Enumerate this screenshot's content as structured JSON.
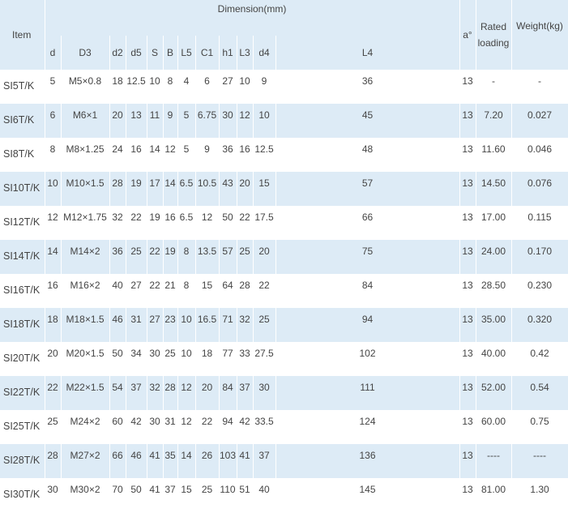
{
  "table": {
    "header": {
      "item": "Item",
      "dimension": "Dimension(mm)",
      "angle": "a°",
      "rated_loading": "Rated loading",
      "weight": "Weight(kg)",
      "columns": [
        "d",
        "D3",
        "d2",
        "d5",
        "S",
        "B",
        "L5",
        "C1",
        "h1",
        "L3",
        "d4",
        "L4"
      ]
    },
    "rows": [
      {
        "item": "SI5T/K",
        "d": "5",
        "D3": "M5×0.8",
        "d2": "18",
        "d5": "12.5",
        "S": "10",
        "B": "8",
        "L5": "4",
        "C1": "6",
        "h1": "27",
        "L3": "10",
        "d4": "9",
        "L4": "36",
        "a": "13",
        "rated": "-",
        "weight": "-"
      },
      {
        "item": "SI6T/K",
        "d": "6",
        "D3": "M6×1",
        "d2": "20",
        "d5": "13",
        "S": "11",
        "B": "9",
        "L5": "5",
        "C1": "6.75",
        "h1": "30",
        "L3": "12",
        "d4": "10",
        "L4": "45",
        "a": "13",
        "rated": "7.20",
        "weight": "0.027"
      },
      {
        "item": "SI8T/K",
        "d": "8",
        "D3": "M8×1.25",
        "d2": "24",
        "d5": "16",
        "S": "14",
        "B": "12",
        "L5": "5",
        "C1": "9",
        "h1": "36",
        "L3": "16",
        "d4": "12.5",
        "L4": "48",
        "a": "13",
        "rated": "11.60",
        "weight": "0.046"
      },
      {
        "item": "SI10T/K",
        "d": "10",
        "D3": "M10×1.5",
        "d2": "28",
        "d5": "19",
        "S": "17",
        "B": "14",
        "L5": "6.5",
        "C1": "10.5",
        "h1": "43",
        "L3": "20",
        "d4": "15",
        "L4": "57",
        "a": "13",
        "rated": "14.50",
        "weight": "0.076"
      },
      {
        "item": "SI12T/K",
        "d": "12",
        "D3": "M12×1.75",
        "d2": "32",
        "d5": "22",
        "S": "19",
        "B": "16",
        "L5": "6.5",
        "C1": "12",
        "h1": "50",
        "L3": "22",
        "d4": "17.5",
        "L4": "66",
        "a": "13",
        "rated": "17.00",
        "weight": "0.115"
      },
      {
        "item": "SI14T/K",
        "d": "14",
        "D3": "M14×2",
        "d2": "36",
        "d5": "25",
        "S": "22",
        "B": "19",
        "L5": "8",
        "C1": "13.5",
        "h1": "57",
        "L3": "25",
        "d4": "20",
        "L4": "75",
        "a": "13",
        "rated": "24.00",
        "weight": "0.170"
      },
      {
        "item": "SI16T/K",
        "d": "16",
        "D3": "M16×2",
        "d2": "40",
        "d5": "27",
        "S": "22",
        "B": "21",
        "L5": "8",
        "C1": "15",
        "h1": "64",
        "L3": "28",
        "d4": "22",
        "L4": "84",
        "a": "13",
        "rated": "28.50",
        "weight": "0.230"
      },
      {
        "item": "SI18T/K",
        "d": "18",
        "D3": "M18×1.5",
        "d2": "46",
        "d5": "31",
        "S": "27",
        "B": "23",
        "L5": "10",
        "C1": "16.5",
        "h1": "71",
        "L3": "32",
        "d4": "25",
        "L4": "94",
        "a": "13",
        "rated": "35.00",
        "weight": "0.320"
      },
      {
        "item": "SI20T/K",
        "d": "20",
        "D3": "M20×1.5",
        "d2": "50",
        "d5": "34",
        "S": "30",
        "B": "25",
        "L5": "10",
        "C1": "18",
        "h1": "77",
        "L3": "33",
        "d4": "27.5",
        "L4": "102",
        "a": "13",
        "rated": "40.00",
        "weight": "0.42"
      },
      {
        "item": "SI22T/K",
        "d": "22",
        "D3": "M22×1.5",
        "d2": "54",
        "d5": "37",
        "S": "32",
        "B": "28",
        "L5": "12",
        "C1": "20",
        "h1": "84",
        "L3": "37",
        "d4": "30",
        "L4": "111",
        "a": "13",
        "rated": "52.00",
        "weight": "0.54"
      },
      {
        "item": "SI25T/K",
        "d": "25",
        "D3": "M24×2",
        "d2": "60",
        "d5": "42",
        "S": "30",
        "B": "31",
        "L5": "12",
        "C1": "22",
        "h1": "94",
        "L3": "42",
        "d4": "33.5",
        "L4": "124",
        "a": "13",
        "rated": "60.00",
        "weight": "0.75"
      },
      {
        "item": "SI28T/K",
        "d": "28",
        "D3": "M27×2",
        "d2": "66",
        "d5": "46",
        "S": "41",
        "B": "35",
        "L5": "14",
        "C1": "26",
        "h1": "103",
        "L3": "41",
        "d4": "37",
        "L4": "136",
        "a": "13",
        "rated": "----",
        "weight": "----"
      },
      {
        "item": "SI30T/K",
        "d": "30",
        "D3": "M30×2",
        "d2": "70",
        "d5": "50",
        "S": "41",
        "B": "37",
        "L5": "15",
        "C1": "25",
        "h1": "110",
        "L3": "51",
        "d4": "40",
        "L4": "145",
        "a": "13",
        "rated": "81.00",
        "weight": "1.30"
      }
    ]
  }
}
